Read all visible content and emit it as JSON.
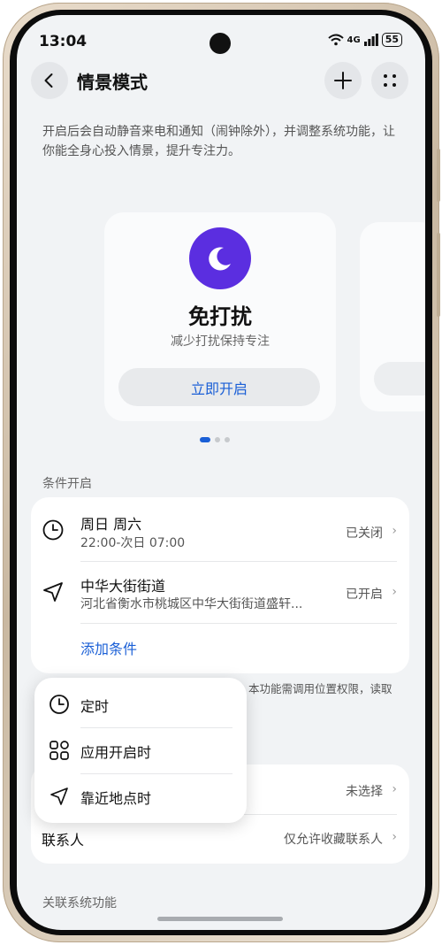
{
  "status_bar": {
    "time": "13:04",
    "network": "4G",
    "battery": "55"
  },
  "header": {
    "title": "情景模式"
  },
  "description": "开启后会自动静音来电和通知（闹钟除外），并调整系统功能，让你能全身心投入情景，提升专注力。",
  "carousel": {
    "cards": [
      {
        "title": "免打扰",
        "subtitle": "减少打扰保持专注",
        "button_label": "立即开启",
        "icon": "moon-icon",
        "icon_color": "#5b2ee0"
      }
    ],
    "page_count": 3,
    "active_page": 1
  },
  "conditions": {
    "section_label": "条件开启",
    "items": [
      {
        "icon": "clock-icon",
        "title": "周日 周六",
        "subtitle": "22:00-次日 07:00",
        "status": "已关闭"
      },
      {
        "icon": "location-arrow-icon",
        "title": "中华大街街道",
        "subtitle": "河北省衡水市桃城区中华大街街道盛轩...",
        "status": "已开启"
      }
    ],
    "add_label": "添加条件"
  },
  "note": "本功能需调用位置权限，读取",
  "popup_menu": {
    "items": [
      {
        "icon": "clock-icon",
        "label": "定时"
      },
      {
        "icon": "apps-grid-icon",
        "label": "应用开启时"
      },
      {
        "icon": "location-arrow-icon",
        "label": "靠近地点时"
      }
    ]
  },
  "settings": {
    "rows": [
      {
        "label": "",
        "value": "未选择"
      },
      {
        "label": "联系人",
        "value": "仅允许收藏联系人"
      }
    ]
  },
  "linked_section_label": "关联系统功能",
  "colors": {
    "accent": "#1a5fd6",
    "screen_bg": "#f1f3f5"
  }
}
